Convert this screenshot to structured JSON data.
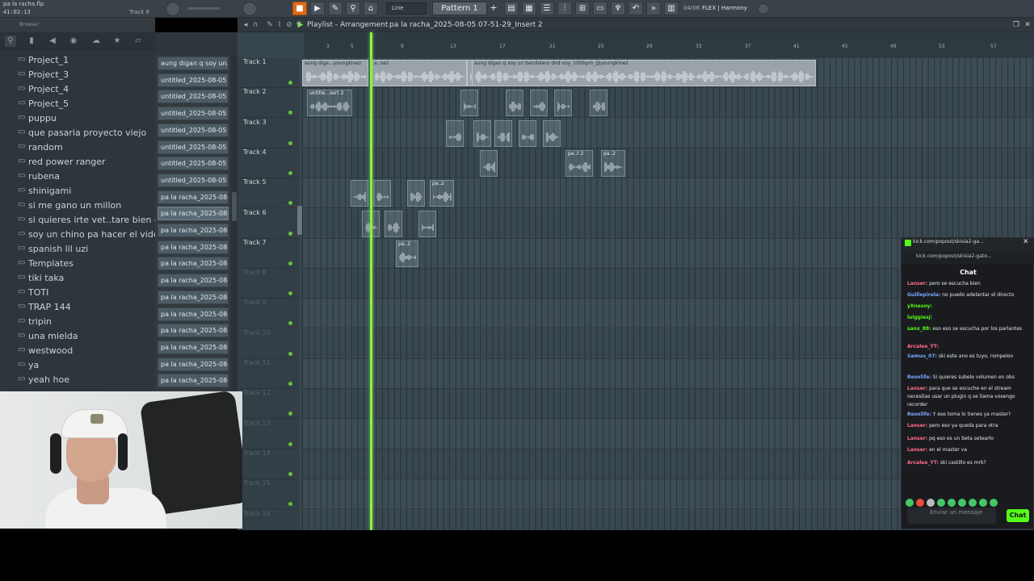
{
  "window": {
    "file_title": "pa la racha.flp",
    "time": "41:02:13",
    "track_hint": "Track 8"
  },
  "toolbar": {
    "snap": "Line",
    "pattern": "Pattern 1",
    "pattern_add": "+",
    "cpu": "04/06",
    "hint": "FLEX | Harmony",
    "record_color": "#e06a1a"
  },
  "browser": {
    "title": "Browser",
    "folders": [
      "Project_1",
      "Project_3",
      "Project_4",
      "Project_5",
      "puppu",
      "que pasaria proyecto viejo",
      "random",
      "red power ranger",
      "rubena",
      "shinigami",
      "si me gano un millon",
      "si quieres irte vet..tare bien con eso",
      "soy un chino pa hacer el video",
      "spanish lil uzi",
      "Templates",
      "tiki taka",
      "TOTI",
      "TRAP 144",
      "tripin",
      "una mielda",
      "westwood",
      "ya",
      "yeah hoe"
    ]
  },
  "clip_list": [
    "aung digan q soy un..",
    "untitled_2025-08-05 07-...",
    "untitled_2025-08-05 07-...",
    "untitled_2025-08-05 07-...",
    "untitled_2025-08-05 07-...",
    "untitled_2025-08-05 07-...",
    "untitled_2025-08-05 07-...",
    "untitled_2025-08-05 07-...",
    "pa la racha_2025-08-05...",
    "pa la racha_2025-08-05...",
    "pa la racha_2025-08-05...",
    "pa la racha_2025-08-05...",
    "pa la racha_2025-08-05...",
    "pa la racha_2025-08-05...",
    "pa la racha_2025-08-05...",
    "pa la racha_2025-08-05...",
    "pa la racha_2025-08-05...",
    "pa la racha_2025-08-05...",
    "pa la racha_2025-08-05...",
    "pa la racha_2025-08-05..."
  ],
  "playlist": {
    "title": "Playlist - Arrangement",
    "arrangement": "pa la racha_2025-08-05 07-51-29_Insert 2",
    "ruler": [
      "3",
      "5",
      "9",
      "13",
      "17",
      "21",
      "25",
      "29",
      "33",
      "37",
      "41",
      "45",
      "49",
      "53",
      "57"
    ],
    "tracks": [
      "Track 1",
      "Track 2",
      "Track 3",
      "Track 4",
      "Track 5",
      "Track 6",
      "Track 7",
      "Track 8",
      "Track 9",
      "Track 10",
      "Track 11",
      "Track 12",
      "Track 13",
      "Track 14",
      "Track 15",
      "Track 16"
    ],
    "clip_labels": {
      "t1a": "aung diga...youngkinez",
      "t1b": "a..nez",
      "t1c": "aung diga...youngkinez",
      "t1d": "aung digan q soy un bandolero dnd voy_100bpm_@youngkinez",
      "t2a": "untitle...sert 2",
      "t4a": "pa..t 2",
      "t4b": "pa..2",
      "t5a": "pa..2",
      "t7a": "pa..2"
    }
  },
  "chat": {
    "title": "kick.com/popout/skisia2-ga...",
    "url": "kick.com/popout/skisia2-gato...",
    "header": "Chat",
    "messages": [
      {
        "user": "Lanser:",
        "text": " pero se escucha bien",
        "color": "#ff6b8a"
      },
      {
        "user": "Guillepirela:",
        "text": " no puedo adelantar el directo",
        "color": "#7aa7ff"
      },
      {
        "user": "yXnesoy:",
        "text": "",
        "color": "#53fc18"
      },
      {
        "user": "luiggiesj:",
        "text": "",
        "color": "#53fc18"
      },
      {
        "user": "sanx_88:",
        "text": " eso eso se escucha por los parlantes",
        "color": "#53fc18"
      },
      {
        "user": "Arcalee_YT:",
        "text": "",
        "color": "#ff6b8a"
      },
      {
        "user": "Samuu_07:",
        "text": " ski este ano es tuyo, rompeloo",
        "color": "#7aa7ff"
      },
      {
        "user": "Reoxlife:",
        "text": " Si quieres subele volumen en obs",
        "color": "#7aa7ff"
      },
      {
        "user": "Lanser:",
        "text": " para que se escuche en el stream necesitas usar un plugin q se llama voxengo recorder",
        "color": "#ff6b8a"
      },
      {
        "user": "Reoxlife:",
        "text": " Y ese tema lo tienes ya master?",
        "color": "#7aa7ff"
      },
      {
        "user": "Lanser:",
        "text": " pero eso ya queda para otra",
        "color": "#ff6b8a"
      },
      {
        "user": "Lanser:",
        "text": " pq eso es un beta setearlo",
        "color": "#ff6b8a"
      },
      {
        "user": "Lanser:",
        "text": " en el master va",
        "color": "#ff6b8a"
      },
      {
        "user": "Arcalee_YT:",
        "text": " ski castillo es mrk?",
        "color": "#ff6b8a"
      }
    ],
    "input_placeholder": "Enviar un mensaje",
    "send_label": "Chat"
  }
}
